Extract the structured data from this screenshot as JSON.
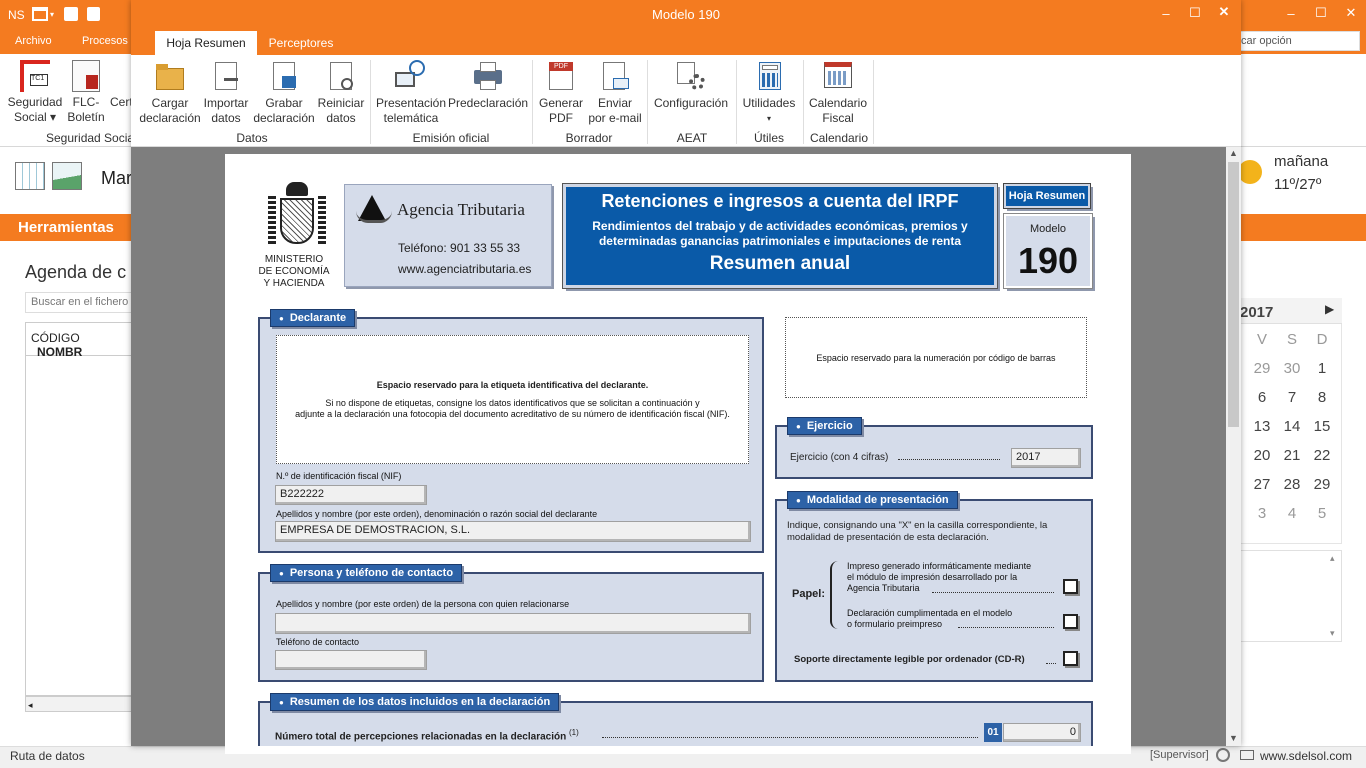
{
  "bg_app": {
    "title_short": "NS",
    "menus": [
      "Archivo",
      "Procesos"
    ],
    "search_placeholder": "car opción",
    "ribbon": [
      {
        "line1": "Seguridad",
        "line2": "Social ▾"
      },
      {
        "line1": "FLC-",
        "line2": "Boletín"
      },
      {
        "line1": "Cert",
        "line2": ""
      }
    ],
    "ribbon_group": "Seguridad Social",
    "doc_label": "Mar",
    "herramientas": "Herramientas",
    "agenda_title": "Agenda de c",
    "search_fichero": "Buscar en el fichero",
    "table_headers": [
      "CÓDIGO",
      "NOMBR"
    ],
    "weather": {
      "day": "mañana",
      "temp": "11º/27º"
    },
    "calendar": {
      "year": "2017",
      "weekdays": [
        "V",
        "S",
        "D"
      ],
      "rows": [
        [
          "29",
          "30",
          "1"
        ],
        [
          "6",
          "7",
          "8"
        ],
        [
          "13",
          "14",
          "15"
        ],
        [
          "20",
          "21",
          "22"
        ],
        [
          "27",
          "28",
          "29"
        ],
        [
          "3",
          "4",
          "5"
        ]
      ]
    },
    "status_left": "Ruta de datos",
    "status_user": "[Supervisor]",
    "status_site": "www.sdelsol.com"
  },
  "dialog": {
    "title": "Modelo 190",
    "tabs": [
      "Hoja Resumen",
      "Perceptores"
    ],
    "ribbon_buttons": [
      {
        "line1": "Cargar",
        "line2": "declaración",
        "icon": "folder-icon"
      },
      {
        "line1": "Importar",
        "line2": "datos",
        "icon": "import-icon"
      },
      {
        "line1": "Grabar",
        "line2": "declaración",
        "icon": "save-doc-icon"
      },
      {
        "line1": "Reiniciar",
        "line2": "datos",
        "icon": "reset-doc-icon"
      },
      {
        "line1": "Presentación",
        "line2": "telemática",
        "icon": "globe-computer-icon"
      },
      {
        "line1": "Predeclaración",
        "line2": "",
        "icon": "printer-icon"
      },
      {
        "line1": "Generar",
        "line2": "PDF",
        "icon": "pdf-icon"
      },
      {
        "line1": "Enviar",
        "line2": "por e-mail",
        "icon": "email-icon"
      },
      {
        "line1": "Configuración",
        "line2": "",
        "icon": "config-icon"
      },
      {
        "line1": "Utilidades",
        "line2": "▾",
        "icon": "calculator-icon"
      },
      {
        "line1": "Calendario",
        "line2": "Fiscal",
        "icon": "calendar-icon"
      }
    ],
    "ribbon_groups": [
      "Datos",
      "Emisión oficial",
      "Borrador",
      "AEAT",
      "Útiles",
      "Calendario"
    ]
  },
  "form": {
    "ministry": [
      "MINISTERIO",
      "DE ECONOMÍA",
      "Y HACIENDA"
    ],
    "agency": "Agencia Tributaria",
    "phone": "Teléfono: 901 33 55 33",
    "web": "www.agenciatributaria.es",
    "header_title": "Retenciones e ingresos a cuenta del IRPF",
    "header_sub1": "Rendimientos del trabajo y de actividades económicas, premios y",
    "header_sub2": "determinadas ganancias patrimoniales e imputaciones de renta",
    "header_resumen": "Resumen anual",
    "hoja_resumen_tag": "Hoja Resumen",
    "modelo_label": "Modelo",
    "modelo_number": "190",
    "declarante": {
      "label": "Declarante",
      "etiqueta_title": "Espacio reservado para la etiqueta identificativa del declarante.",
      "etiqueta_text1": "Si no dispone de etiquetas, consigne los datos identificativos que se solicitan a continuación y",
      "etiqueta_text2": "adjunte a la declaración una fotocopia del documento acreditativo de su número de identificación fiscal (NIF).",
      "nif_label": "N.º de identificación fiscal (NIF)",
      "nif_value": "B222222",
      "nombre_label": "Apellidos y nombre (por este orden), denominación o razón social del declarante",
      "nombre_value": "EMPRESA DE DEMOSTRACION, S.L."
    },
    "barcode_text": "Espacio reservado para la numeración por código de barras",
    "ejercicio": {
      "label": "Ejercicio",
      "field_label": "Ejercicio (con 4 cifras)",
      "value": "2017"
    },
    "modalidad": {
      "label": "Modalidad de presentación",
      "intro1": "Indique, consignando una \"X\" en la casilla correspondiente, la",
      "intro2": "modalidad de presentación de esta declaración.",
      "papel": "Papel:",
      "opt1": [
        "Impreso generado informáticamente mediante",
        "el módulo de impresión desarrollado por la",
        "Agencia Tributaria"
      ],
      "opt2": [
        "Declaración cumplimentada en el modelo",
        "o formulario preimpreso"
      ],
      "soporte": "Soporte directamente legible por ordenador (CD-R)"
    },
    "contacto": {
      "label": "Persona y teléfono de contacto",
      "nombre_label": "Apellidos y nombre (por este orden) de la persona con quien relacionarse",
      "nombre_value": "",
      "tel_label": "Teléfono de contacto",
      "tel_value": ""
    },
    "resumen": {
      "label": "Resumen de los datos incluidos en la declaración",
      "row_label": "Número total de percepciones relacionadas en la declaración",
      "row_note": "(1)",
      "row_code": "01",
      "row_value": "0"
    }
  }
}
